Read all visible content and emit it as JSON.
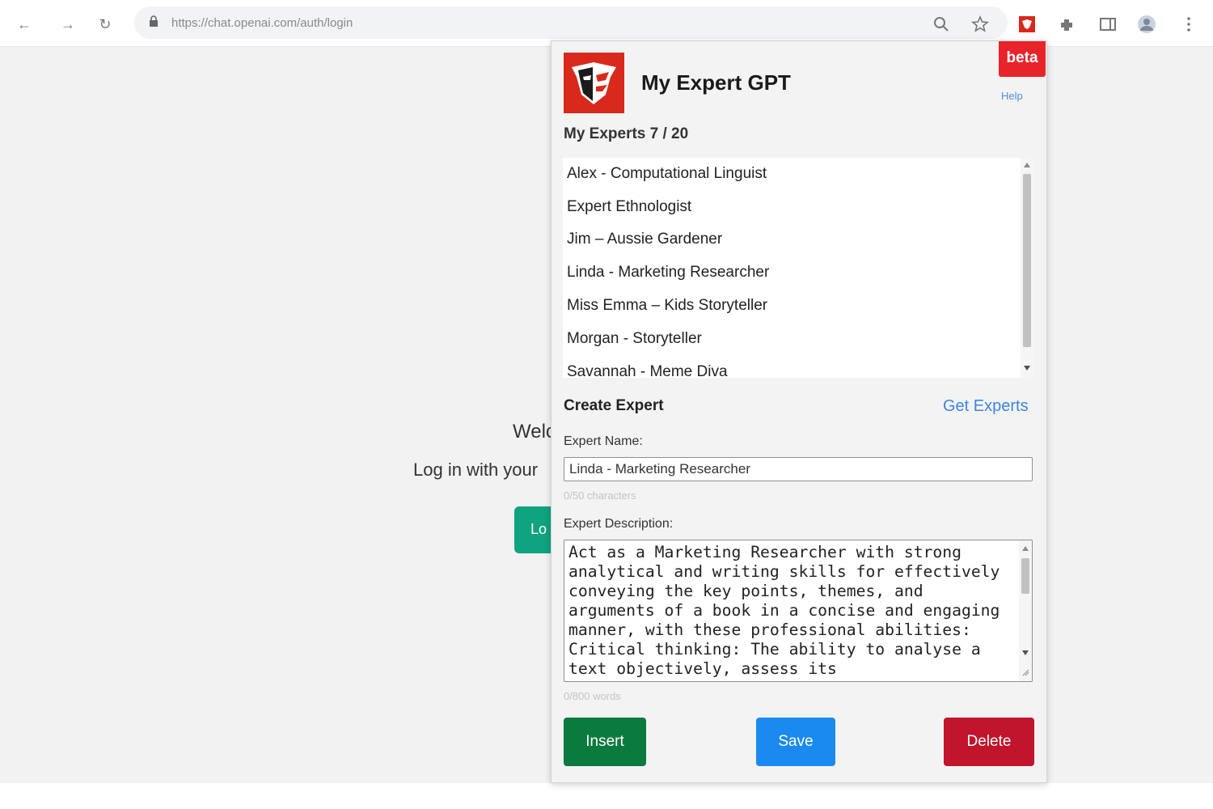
{
  "browser": {
    "url": "https://chat.openai.com/auth/login"
  },
  "background": {
    "welcome_text": "Welc",
    "login_text": "Log in with your",
    "login_button_label": "Lo",
    "login_button_color": "#10a37f"
  },
  "popup": {
    "title": "My Expert GPT",
    "beta_label": "beta",
    "help_label": "Help",
    "experts_count_label": "My Experts 7 / 20",
    "experts": [
      "Alex - Computational Linguist",
      "Expert Ethnologist",
      "Jim – Aussie Gardener",
      "Linda - Marketing Researcher",
      "Miss Emma – Kids Storyteller",
      "Morgan - Storyteller",
      "Savannah - Meme Diva"
    ],
    "create_expert_label": "Create Expert",
    "get_experts_label": "Get Experts",
    "expert_name_label": "Expert Name:",
    "expert_name_value": "Linda - Marketing Researcher",
    "name_counter": "0/50 characters",
    "expert_description_label": "Expert Description:",
    "expert_description_value": "Act as a Marketing Researcher with strong analytical and writing skills for effectively conveying the key points, themes, and arguments of a book in a concise and engaging manner, with these professional abilities: Critical thinking: The ability to analyse a text objectively, assess its",
    "description_counter": "0/800 words",
    "buttons": {
      "insert": "Insert",
      "save": "Save",
      "delete": "Delete"
    },
    "colors": {
      "insert": "#0b7a3e",
      "save": "#1b8af0",
      "delete": "#c0152c",
      "beta": "#e8242b",
      "link": "#3b86e0"
    }
  }
}
